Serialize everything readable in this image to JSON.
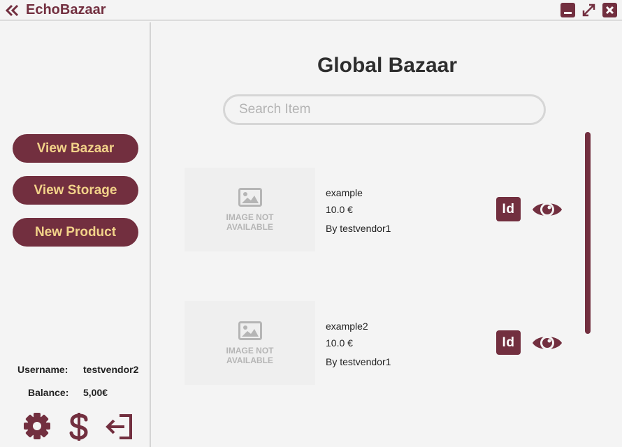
{
  "app": {
    "title": "EchoBazaar"
  },
  "window": {
    "icons": {
      "back": "double-chevron-left-icon",
      "minimize": "minimize-icon",
      "maximize": "maximize-icon",
      "close": "close-icon"
    }
  },
  "sidebar": {
    "nav": [
      {
        "label": "View Bazaar"
      },
      {
        "label": "View Storage"
      },
      {
        "label": "New Product"
      }
    ],
    "user": {
      "username_label": "Username:",
      "username": "testvendor2",
      "balance_label": "Balance:",
      "balance": "5,00€"
    },
    "footer_icons": [
      "gear-icon",
      "dollar-icon",
      "logout-icon"
    ]
  },
  "main": {
    "title": "Global Bazaar",
    "search": {
      "placeholder": "Search Item",
      "value": ""
    },
    "items": [
      {
        "image_text_1": "IMAGE NOT",
        "image_text_2": "AVAILABLE",
        "name": "example",
        "price": "10.0 €",
        "vendor": "By testvendor1",
        "id_label": "Id"
      },
      {
        "image_text_1": "IMAGE NOT",
        "image_text_2": "AVAILABLE",
        "name": "example2",
        "price": "10.0 €",
        "vendor": "By testvendor1",
        "id_label": "Id"
      }
    ]
  },
  "colors": {
    "accent": "#722f3f",
    "accent_text": "#f2d289",
    "background": "#f4f4f4"
  }
}
